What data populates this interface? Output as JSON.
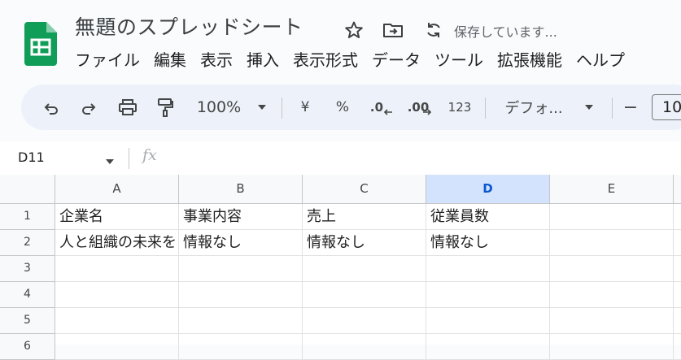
{
  "app": {
    "doc_title": "無題のスプレッドシート",
    "save_status": "保存しています...",
    "brand_color": "#0f9d58"
  },
  "menu": [
    "ファイル",
    "編集",
    "表示",
    "挿入",
    "表示形式",
    "データ",
    "ツール",
    "拡張機能",
    "ヘルプ"
  ],
  "toolbar": {
    "zoom": "100%",
    "currency": "¥",
    "percent": "%",
    "decrease_decimal": ".0",
    "increase_decimal": ".00",
    "number_format": "123",
    "font": "デフォ...",
    "minus": "−",
    "font_size": "10"
  },
  "formula_bar": {
    "cell_ref": "D11",
    "fx": "fx",
    "content": ""
  },
  "grid": {
    "columns": [
      "A",
      "B",
      "C",
      "D",
      "E"
    ],
    "selected_column": "D",
    "row_numbers": [
      "1",
      "2",
      "3",
      "4",
      "5",
      "6"
    ],
    "rows": [
      [
        "企業名",
        "事業内容",
        "売上",
        "従業員数",
        ""
      ],
      [
        "人と組織の未来を",
        "情報なし",
        "情報なし",
        "情報なし",
        ""
      ],
      [
        "",
        "",
        "",
        "",
        ""
      ],
      [
        "",
        "",
        "",
        "",
        ""
      ],
      [
        "",
        "",
        "",
        "",
        ""
      ],
      [
        "",
        "",
        "",
        "",
        ""
      ]
    ]
  }
}
